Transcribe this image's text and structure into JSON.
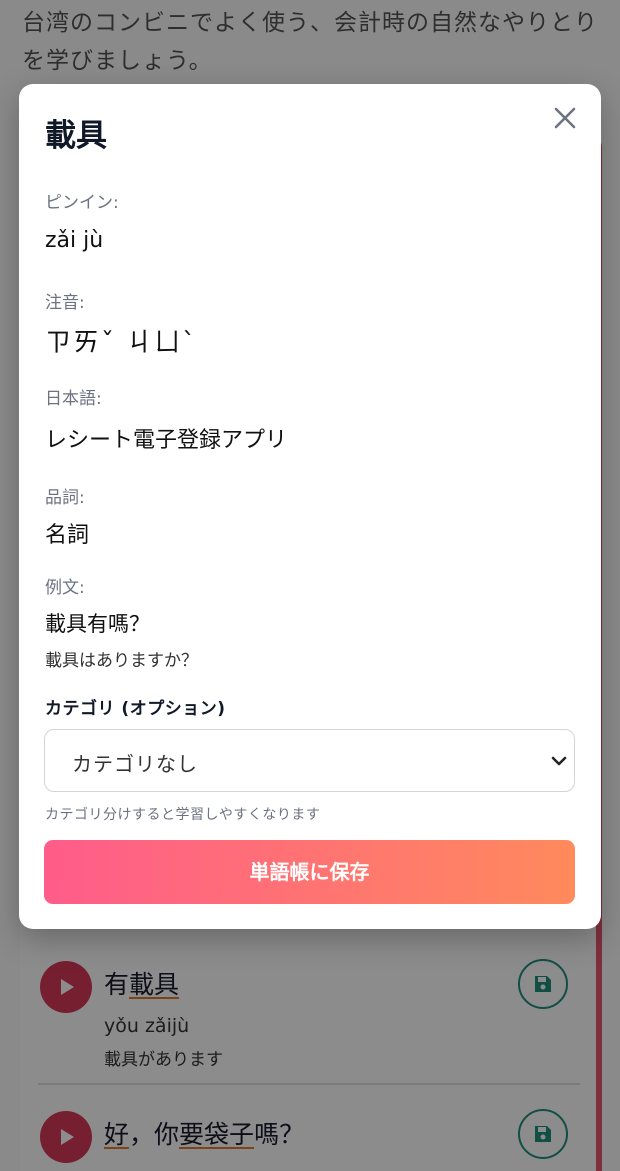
{
  "background": {
    "intro_text": "台湾のコンビニでよく使う、会計時の自然なやりとりを学びましょう。",
    "phrases": [
      {
        "zh_parts": [
          {
            "text": "有",
            "underline": false
          },
          {
            "text": "載具",
            "underline": true
          }
        ],
        "pinyin": "yǒu zǎijù",
        "japanese": "載具があります"
      },
      {
        "zh_parts": [
          {
            "text": "好",
            "underline": true
          },
          {
            "text": "，你",
            "underline": false
          },
          {
            "text": "要",
            "underline": true
          },
          {
            "text": "袋子",
            "underline": true
          },
          {
            "text": "嗎？",
            "underline": false
          }
        ]
      }
    ]
  },
  "modal": {
    "title": "載具",
    "pinyin_label": "ピンイン:",
    "pinyin_value": "zǎi jù",
    "zhuyin_label": "注音:",
    "zhuyin_value": "ㄗㄞˇ ㄐㄩˋ",
    "japanese_label": "日本語:",
    "japanese_value": "レシート電子登録アプリ",
    "pos_label": "品詞:",
    "pos_value": "名詞",
    "example_label": "例文:",
    "example_zh": "載具有嗎？",
    "example_ja": "載具はありますか？",
    "category_label": "カテゴリ (オプション)",
    "category_selected": "カテゴリなし",
    "category_hint": "カテゴリ分けすると学習しやすくなります",
    "save_button": "単語帳に保存"
  },
  "icons": {
    "close": "close-icon",
    "chevron": "chevron-down-icon",
    "play": "play-icon",
    "save": "floppy-disk-icon"
  },
  "colors": {
    "accent_gradient_start": "#ff5c8a",
    "accent_gradient_end": "#ff8a5c",
    "play_button": "#d63a5a",
    "save_ring": "#1f8f7a"
  }
}
